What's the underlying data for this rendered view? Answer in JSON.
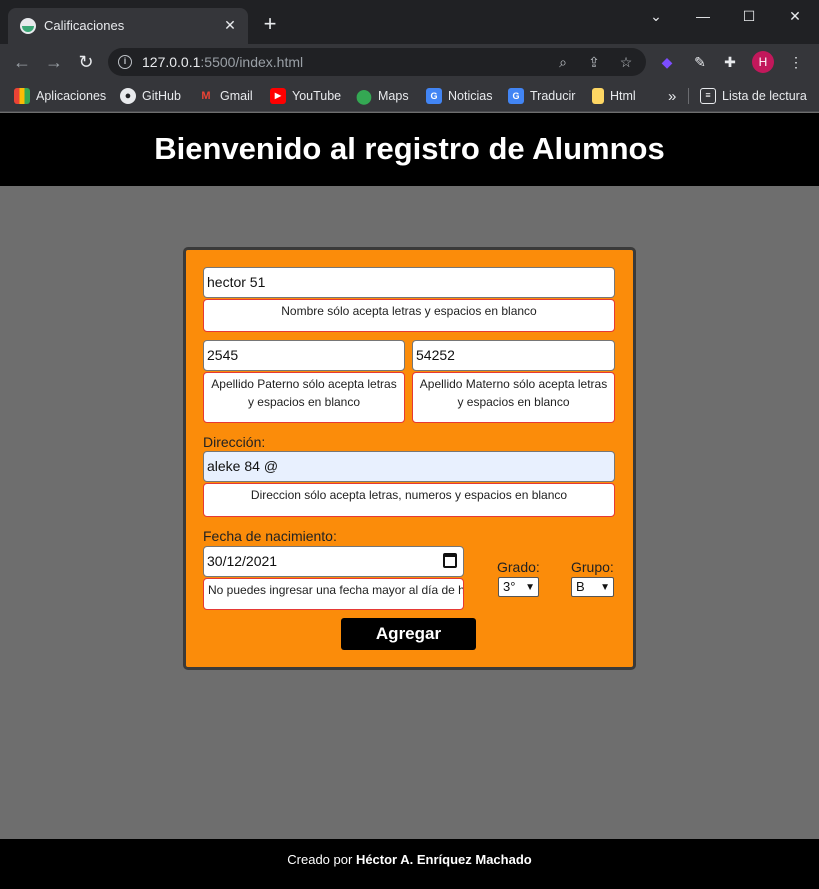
{
  "browser": {
    "tab_title": "Calificaciones",
    "tab_close": "✕",
    "new_tab": "+",
    "window_controls": {
      "chevron": "⌄",
      "minimize": "—",
      "maximize": "☐",
      "close": "✕"
    },
    "url_host": "127.0.0.1",
    "url_rest": ":5500/index.html",
    "bookmarks": [
      {
        "label": "Aplicaciones",
        "icon": "apps-grid-icon",
        "color": "#ea4335"
      },
      {
        "label": "GitHub",
        "icon": "github-icon",
        "color": "#e8eaed"
      },
      {
        "label": "Gmail",
        "icon": "gmail-icon",
        "color": "#ea4335"
      },
      {
        "label": "YouTube",
        "icon": "youtube-icon",
        "color": "#ff0000"
      },
      {
        "label": "Maps",
        "icon": "maps-icon",
        "color": "#34a853"
      },
      {
        "label": "Noticias",
        "icon": "news-icon",
        "color": "#4285f4"
      },
      {
        "label": "Traducir",
        "icon": "translate-icon",
        "color": "#4285f4"
      },
      {
        "label": "Html",
        "icon": "folder-icon",
        "color": "#fdd663"
      }
    ],
    "overflow": "»",
    "reading_list": "Lista de lectura",
    "avatar_letter": "H"
  },
  "page": {
    "title": "Bienvenido al registro de Alumnos",
    "colors": {
      "header": "#000000",
      "background": "#6e6e6e",
      "card": "#fb8c0a",
      "error_border": "#e53935"
    }
  },
  "form": {
    "nombre": {
      "value": "hector 51",
      "error": "Nombre sólo acepta letras y espacios en blanco"
    },
    "apellido_paterno": {
      "value": "2545",
      "error": "Apellido Paterno sólo acepta letras y espacios en blanco"
    },
    "apellido_materno": {
      "value": "54252",
      "error": "Apellido Materno sólo acepta letras y espacios en blanco"
    },
    "direccion": {
      "label": "Dirección:",
      "value": "aleke 84 @",
      "error": "Direccion sólo acepta letras, numeros y espacios en blanco"
    },
    "fecha": {
      "label": "Fecha de nacimiento:",
      "value": "30/12/2021",
      "error": "No puedes ingresar una fecha mayor al día de hoy"
    },
    "grado": {
      "label": "Grado:",
      "value": "3°"
    },
    "grupo": {
      "label": "Grupo:",
      "value": "B"
    },
    "submit_label": "Agregar"
  },
  "footer": {
    "prefix": "Creado por",
    "author": "Héctor A. Enríquez Machado"
  }
}
